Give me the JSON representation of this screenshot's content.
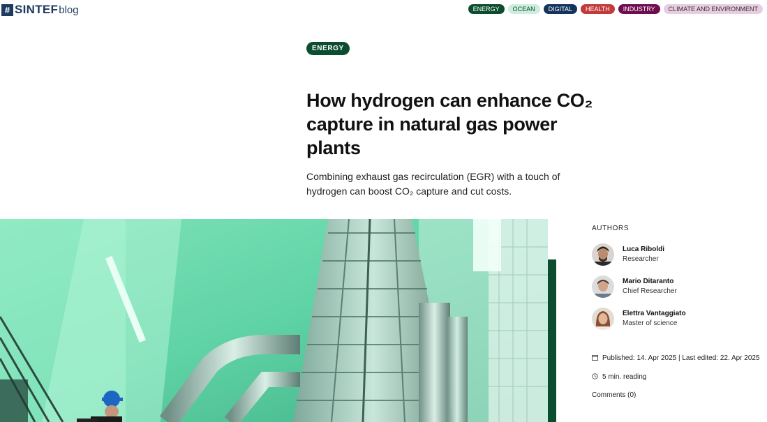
{
  "header": {
    "logo_hash": "#",
    "logo_name": "SINTEF",
    "logo_suffix": "blog",
    "nav": [
      "ENERGY",
      "OCEAN",
      "DIGITAL",
      "HEALTH",
      "INDUSTRY",
      "CLIMATE AND ENVIRONMENT"
    ]
  },
  "article": {
    "category": "ENERGY",
    "title": "How hydrogen can enhance CO₂ capture in natural gas power plants",
    "lead": "Combining exhaust gas recirculation (EGR) with a touch of hydrogen can boost CO₂ capture and cut costs."
  },
  "sidebar": {
    "authors_heading": "AUTHORS",
    "authors": [
      {
        "name": "Luca Riboldi",
        "role": "Researcher"
      },
      {
        "name": "Mario Ditaranto",
        "role": "Chief Researcher"
      },
      {
        "name": "Elettra Vantaggiato",
        "role": "Master of science"
      }
    ],
    "published": "Published: 14. Apr 2025 | Last edited: 22. Apr 2025",
    "reading": "5 min. reading",
    "comments": "Comments (0)"
  },
  "icons": {
    "calendar": "calendar-icon",
    "clock": "clock-icon"
  },
  "colors": {
    "energy_green": "#0b4d2e",
    "brand_navy": "#1e3a5f"
  }
}
